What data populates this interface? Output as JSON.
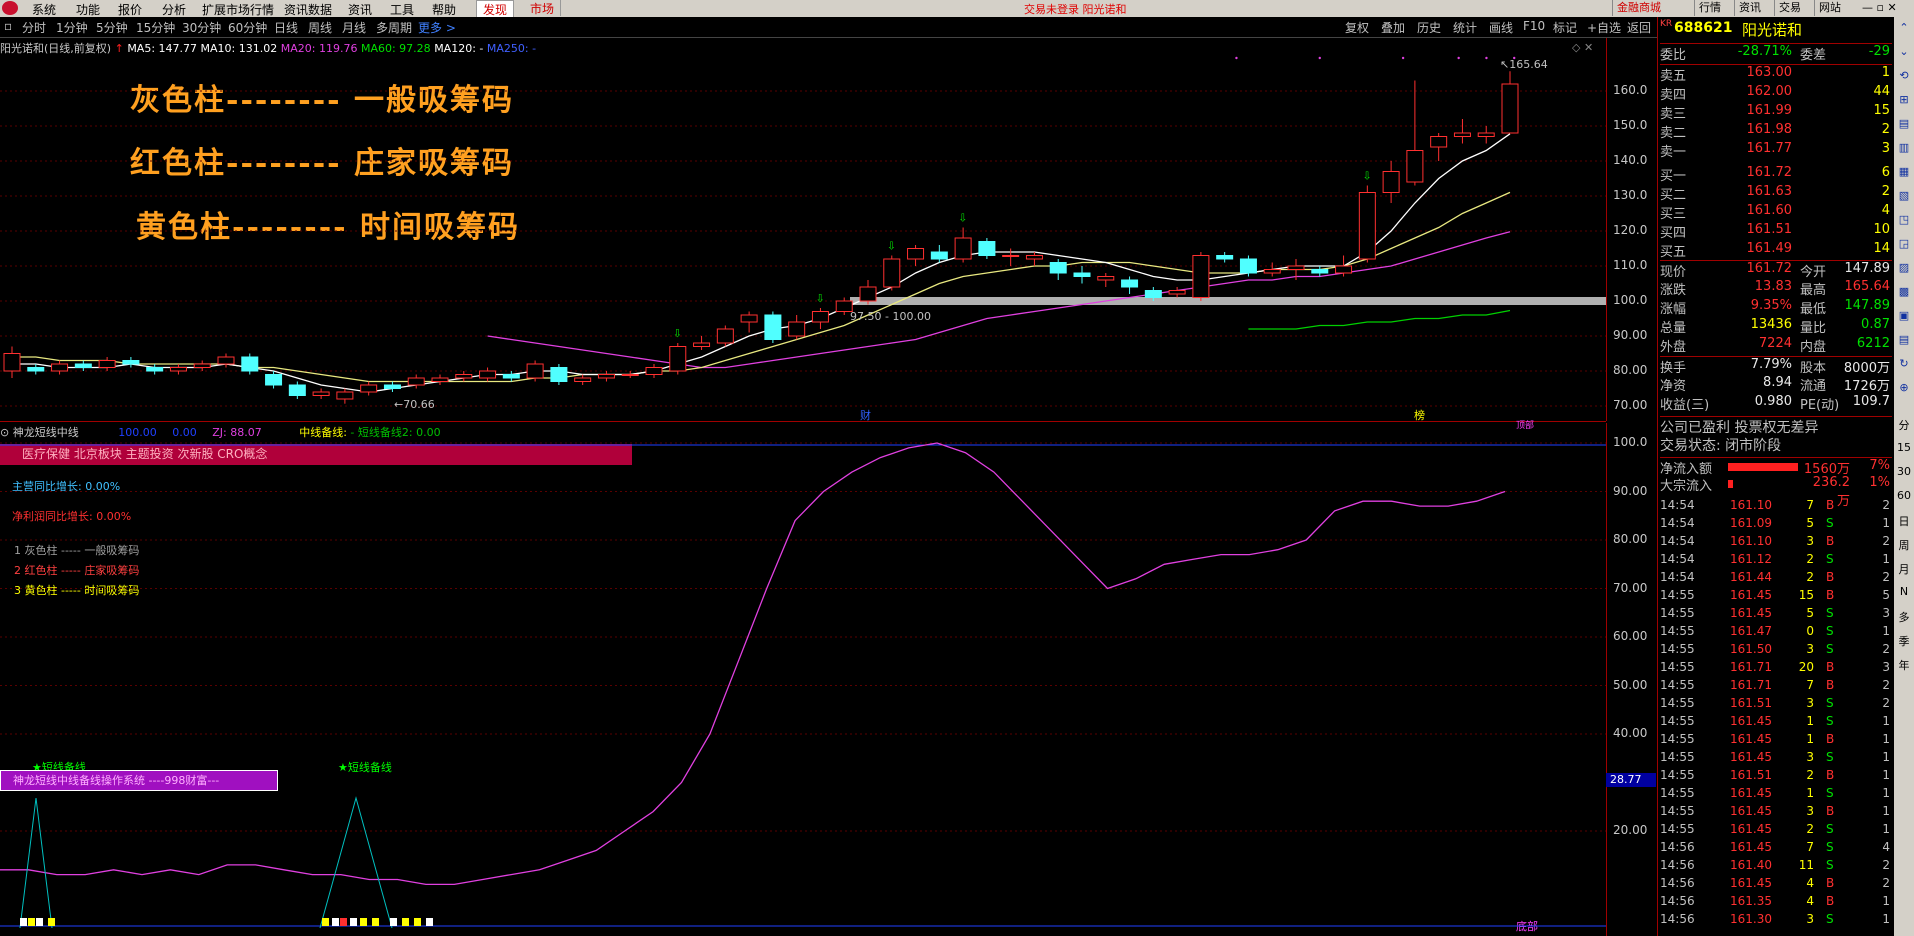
{
  "menu": {
    "items": [
      "系统",
      "功能",
      "报价",
      "分析",
      "扩展市场行情",
      "资讯数据",
      "资讯",
      "工具",
      "帮助"
    ],
    "tab_active": "发现",
    "tab_market": "市场",
    "status_text": "交易未登录  阳光诺和",
    "right_buttons": [
      "金融商城",
      "行情",
      "资讯",
      "交易",
      "网站"
    ]
  },
  "toolbar": {
    "periods": [
      "分时",
      "1分钟",
      "5分钟",
      "15分钟",
      "30分钟",
      "60分钟",
      "日线",
      "周线",
      "月线",
      "多周期"
    ],
    "more": "更多 >",
    "right": [
      "复权",
      "叠加",
      "历史",
      "统计",
      "画线",
      "F10",
      "标记",
      "+自选",
      "返回"
    ]
  },
  "main": {
    "title": "阳光诺和(日线,前复权)",
    "ma": [
      {
        "label": "MA5: 147.77",
        "color": "#ffffff"
      },
      {
        "label": "MA10: 131.02",
        "color": "#ffffff"
      },
      {
        "label": "MA20: 119.76",
        "color": "#e040e0"
      },
      {
        "label": "MA60: 97.28",
        "color": "#00e000"
      },
      {
        "label": "MA120: -",
        "color": "#ffffff"
      },
      {
        "label": "MA250: -",
        "color": "#4060ff"
      }
    ],
    "annotations": [
      "灰色柱--------    一般吸筹码",
      "红色柱--------    庄家吸筹码",
      "黄色柱--------    时间吸筹码"
    ],
    "high_label": "165.64",
    "low_label": "70.66",
    "range_label": "97.50 - 100.00",
    "marker_cai": "财",
    "marker_bang": "榜",
    "y_ticks": [
      "160.0",
      "150.0",
      "140.0",
      "130.0",
      "120.0",
      "110.0",
      "100.0",
      "90.00",
      "80.00",
      "70.00"
    ]
  },
  "sub": {
    "title": "神龙短线中线",
    "v1": "100.00",
    "v2": "0.00",
    "zj": "ZJ: 88.07",
    "line_label": "中线备线:",
    "line2": "- 短线备线2: 0.00",
    "concepts": "医疗保健 北京板块 主题投资 次新股 CRO概念",
    "growth1": "主营同比增长:  0.00%",
    "growth2": "净利润同比增长:  0.00%",
    "legend": [
      "1 灰色柱 ----- 一般吸筹码",
      "2 红色柱 -----  庄家吸筹码",
      "3 黄色柱 -----  时间吸筹码"
    ],
    "star_label": "★短线备线",
    "system_banner": "神龙短线中线备线操作系统 ----998财富---",
    "bottom_label": "底部",
    "top_label": "顶部",
    "cursor_value": "28.77",
    "y_ticks": [
      "100.0",
      "90.00",
      "80.00",
      "70.00",
      "60.00",
      "50.00",
      "40.00",
      "20.00"
    ],
    "line_values": [
      12,
      12,
      11,
      11,
      12,
      11,
      12,
      11,
      13,
      13,
      12,
      11,
      11,
      10,
      10,
      9,
      9,
      10,
      11,
      12,
      14,
      16,
      20,
      24,
      30,
      40,
      55,
      70,
      84,
      90,
      94,
      97,
      99,
      100,
      98,
      94,
      88,
      82,
      76,
      70,
      72,
      75,
      76,
      77,
      77,
      78,
      80,
      86,
      88,
      88,
      87,
      87,
      88,
      90
    ]
  },
  "panel": {
    "code": "688621",
    "name": "阳光诺和",
    "kr": "KR",
    "weibi": {
      "label": "委比",
      "value": "-28.71%",
      "label2": "委差",
      "value2": "-29"
    },
    "asks": [
      {
        "label": "卖五",
        "price": "163.00",
        "vol": "1"
      },
      {
        "label": "卖四",
        "price": "162.00",
        "vol": "44"
      },
      {
        "label": "卖三",
        "price": "161.99",
        "vol": "15"
      },
      {
        "label": "卖二",
        "price": "161.98",
        "vol": "2"
      },
      {
        "label": "卖一",
        "price": "161.77",
        "vol": "3"
      }
    ],
    "bids": [
      {
        "label": "买一",
        "price": "161.72",
        "vol": "6"
      },
      {
        "label": "买二",
        "price": "161.63",
        "vol": "2"
      },
      {
        "label": "买三",
        "price": "161.60",
        "vol": "4"
      },
      {
        "label": "买四",
        "price": "161.51",
        "vol": "10"
      },
      {
        "label": "买五",
        "price": "161.49",
        "vol": "14"
      }
    ],
    "quote": [
      {
        "l1": "现价",
        "v1": "161.72",
        "l2": "今开",
        "v2": "147.89"
      },
      {
        "l1": "涨跌",
        "v1": "13.83",
        "l2": "最高",
        "v2": "165.64"
      },
      {
        "l1": "涨幅",
        "v1": "9.35%",
        "l2": "最低",
        "v2": "147.89"
      },
      {
        "l1": "总量",
        "v1": "13436",
        "l2": "量比",
        "v2": "0.87"
      },
      {
        "l1": "外盘",
        "v1": "7224",
        "l2": "内盘",
        "v2": "6212"
      }
    ],
    "stats": [
      {
        "l1": "换手",
        "v1": "7.79%",
        "l2": "股本",
        "v2": "8000万"
      },
      {
        "l1": "净资",
        "v1": "8.94",
        "l2": "流通",
        "v2": "1726万"
      },
      {
        "l1": "收益(三)",
        "v1": "0.980",
        "l2": "PE(动)",
        "v2": "109.7"
      }
    ],
    "info1": "公司已盈利 投票权无差异",
    "info2": "交易状态: 闭市阶段",
    "flow": [
      {
        "label": "净流入额",
        "value": "1560万",
        "pct": "7%",
        "fill": 0.78
      },
      {
        "label": "大宗流入",
        "value": "236.2万",
        "pct": "1%",
        "fill": 0.06
      }
    ],
    "ticks": [
      [
        "14:54",
        "161.10",
        "7",
        "B",
        "2"
      ],
      [
        "14:54",
        "161.09",
        "5",
        "S",
        "1"
      ],
      [
        "14:54",
        "161.10",
        "3",
        "B",
        "2"
      ],
      [
        "14:54",
        "161.12",
        "2",
        "S",
        "1"
      ],
      [
        "14:54",
        "161.44",
        "2",
        "B",
        "2"
      ],
      [
        "14:55",
        "161.45",
        "15",
        "B",
        "5"
      ],
      [
        "14:55",
        "161.45",
        "5",
        "S",
        "3"
      ],
      [
        "14:55",
        "161.47",
        "0",
        "S",
        "1"
      ],
      [
        "14:55",
        "161.50",
        "3",
        "S",
        "2"
      ],
      [
        "14:55",
        "161.71",
        "20",
        "B",
        "3"
      ],
      [
        "14:55",
        "161.71",
        "7",
        "B",
        "2"
      ],
      [
        "14:55",
        "161.51",
        "3",
        "S",
        "2"
      ],
      [
        "14:55",
        "161.45",
        "1",
        "S",
        "1"
      ],
      [
        "14:55",
        "161.45",
        "1",
        "B",
        "1"
      ],
      [
        "14:55",
        "161.45",
        "3",
        "S",
        "1"
      ],
      [
        "14:55",
        "161.51",
        "2",
        "B",
        "1"
      ],
      [
        "14:55",
        "161.45",
        "1",
        "S",
        "1"
      ],
      [
        "14:55",
        "161.45",
        "3",
        "B",
        "1"
      ],
      [
        "14:55",
        "161.45",
        "2",
        "S",
        "1"
      ],
      [
        "14:56",
        "161.45",
        "7",
        "S",
        "4"
      ],
      [
        "14:56",
        "161.40",
        "11",
        "S",
        "2"
      ],
      [
        "14:56",
        "161.45",
        "4",
        "B",
        "2"
      ],
      [
        "14:56",
        "161.35",
        "4",
        "B",
        "1"
      ],
      [
        "14:56",
        "161.30",
        "3",
        "S",
        "1"
      ]
    ]
  },
  "sidebar": [
    "分",
    "15",
    "30",
    "60",
    "日",
    "周",
    "月",
    "N",
    "多",
    "季",
    "年"
  ],
  "chart_data": {
    "type": "candlestick",
    "title": "阳光诺和(日线,前复权)",
    "ylim": [
      68,
      168
    ],
    "candles": [
      {
        "o": 80,
        "c": 85,
        "h": 87,
        "l": 78
      },
      {
        "o": 81,
        "c": 80,
        "h": 82,
        "l": 79
      },
      {
        "o": 80,
        "c": 82,
        "h": 83,
        "l": 79
      },
      {
        "o": 82,
        "c": 81,
        "h": 83,
        "l": 80
      },
      {
        "o": 81,
        "c": 83,
        "h": 84,
        "l": 80
      },
      {
        "o": 83,
        "c": 82,
        "h": 84,
        "l": 81
      },
      {
        "o": 81,
        "c": 80,
        "h": 82,
        "l": 79
      },
      {
        "o": 80,
        "c": 81,
        "h": 82,
        "l": 79
      },
      {
        "o": 81,
        "c": 82,
        "h": 83,
        "l": 80
      },
      {
        "o": 82,
        "c": 84,
        "h": 85,
        "l": 81
      },
      {
        "o": 84,
        "c": 80,
        "h": 85,
        "l": 79
      },
      {
        "o": 79,
        "c": 76,
        "h": 80,
        "l": 75
      },
      {
        "o": 76,
        "c": 73,
        "h": 77,
        "l": 72
      },
      {
        "o": 73,
        "c": 74,
        "h": 75,
        "l": 72
      },
      {
        "o": 72,
        "c": 74,
        "h": 75,
        "l": 70.66
      },
      {
        "o": 74,
        "c": 76,
        "h": 77,
        "l": 73
      },
      {
        "o": 76,
        "c": 75,
        "h": 77,
        "l": 74
      },
      {
        "o": 76,
        "c": 78,
        "h": 79,
        "l": 75
      },
      {
        "o": 77,
        "c": 78,
        "h": 79,
        "l": 76
      },
      {
        "o": 78,
        "c": 79,
        "h": 80,
        "l": 77
      },
      {
        "o": 78,
        "c": 80,
        "h": 81,
        "l": 77
      },
      {
        "o": 79,
        "c": 78,
        "h": 80,
        "l": 77
      },
      {
        "o": 78,
        "c": 82,
        "h": 83,
        "l": 77
      },
      {
        "o": 81,
        "c": 77,
        "h": 82,
        "l": 76
      },
      {
        "o": 77,
        "c": 78,
        "h": 79,
        "l": 76
      },
      {
        "o": 78,
        "c": 79,
        "h": 80,
        "l": 77
      },
      {
        "o": 79,
        "c": 79,
        "h": 80,
        "l": 78
      },
      {
        "o": 79,
        "c": 81,
        "h": 82,
        "l": 78
      },
      {
        "o": 80,
        "c": 87,
        "h": 88,
        "l": 79
      },
      {
        "o": 87,
        "c": 88,
        "h": 90,
        "l": 86
      },
      {
        "o": 88,
        "c": 92,
        "h": 93,
        "l": 87
      },
      {
        "o": 94,
        "c": 96,
        "h": 97,
        "l": 91
      },
      {
        "o": 96,
        "c": 89,
        "h": 97,
        "l": 88
      },
      {
        "o": 90,
        "c": 94,
        "h": 96,
        "l": 89
      },
      {
        "o": 94,
        "c": 97,
        "h": 98,
        "l": 92
      },
      {
        "o": 97,
        "c": 100,
        "h": 101,
        "l": 96
      },
      {
        "o": 100,
        "c": 104,
        "h": 106,
        "l": 99
      },
      {
        "o": 104,
        "c": 112,
        "h": 113,
        "l": 103
      },
      {
        "o": 112,
        "c": 115,
        "h": 116,
        "l": 110
      },
      {
        "o": 114,
        "c": 112,
        "h": 116,
        "l": 111
      },
      {
        "o": 112,
        "c": 118,
        "h": 121,
        "l": 111
      },
      {
        "o": 117,
        "c": 113,
        "h": 118,
        "l": 112
      },
      {
        "o": 113,
        "c": 113,
        "h": 115,
        "l": 110
      },
      {
        "o": 112,
        "c": 113,
        "h": 114,
        "l": 110
      },
      {
        "o": 111,
        "c": 108,
        "h": 112,
        "l": 106
      },
      {
        "o": 108,
        "c": 107,
        "h": 110,
        "l": 105
      },
      {
        "o": 106,
        "c": 107,
        "h": 108,
        "l": 104
      },
      {
        "o": 106,
        "c": 104,
        "h": 107,
        "l": 102
      },
      {
        "o": 103,
        "c": 101,
        "h": 104,
        "l": 100
      },
      {
        "o": 102,
        "c": 103,
        "h": 104,
        "l": 101
      },
      {
        "o": 101,
        "c": 113,
        "h": 114,
        "l": 100
      },
      {
        "o": 113,
        "c": 112,
        "h": 114,
        "l": 111
      },
      {
        "o": 112,
        "c": 108,
        "h": 113,
        "l": 107
      },
      {
        "o": 108,
        "c": 109,
        "h": 111,
        "l": 107
      },
      {
        "o": 109,
        "c": 110,
        "h": 112,
        "l": 106
      },
      {
        "o": 109,
        "c": 108,
        "h": 110,
        "l": 107
      },
      {
        "o": 108,
        "c": 110,
        "h": 113,
        "l": 107
      },
      {
        "o": 112,
        "c": 131,
        "h": 133,
        "l": 111
      },
      {
        "o": 131,
        "c": 137,
        "h": 140,
        "l": 128
      },
      {
        "o": 134,
        "c": 143,
        "h": 163,
        "l": 133
      },
      {
        "o": 144,
        "c": 147,
        "h": 148,
        "l": 140
      },
      {
        "o": 147,
        "c": 148,
        "h": 152,
        "l": 145
      },
      {
        "o": 147,
        "c": 148,
        "h": 150,
        "l": 145
      },
      {
        "o": 148,
        "c": 162,
        "h": 165.64,
        "l": 147.89
      }
    ],
    "ma5": [
      82,
      82,
      81,
      81,
      81,
      82,
      81,
      81,
      81,
      82,
      81,
      80,
      78,
      76,
      75,
      74,
      75,
      76,
      77,
      78,
      79,
      79,
      80,
      80,
      79,
      79,
      79,
      80,
      82,
      84,
      87,
      90,
      92,
      93,
      95,
      98,
      101,
      104,
      108,
      111,
      113,
      114,
      114,
      114,
      113,
      112,
      111,
      109,
      107,
      106,
      106,
      107,
      108,
      109,
      110,
      110,
      110,
      114,
      120,
      128,
      135,
      140,
      143,
      147.77
    ],
    "ma10": [
      84,
      84,
      83,
      83,
      83,
      82,
      82,
      82,
      82,
      82,
      81,
      81,
      80,
      79,
      78,
      77,
      77,
      77,
      77,
      77,
      77,
      77,
      78,
      78,
      79,
      79,
      79,
      80,
      80,
      81,
      83,
      85,
      87,
      89,
      91,
      93,
      96,
      99,
      102,
      105,
      107,
      108,
      109,
      110,
      110,
      111,
      111,
      111,
      110,
      109,
      108,
      108,
      108,
      109,
      109,
      109,
      110,
      112,
      115,
      118,
      121,
      125,
      128,
      131.02
    ],
    "ma20": [
      null,
      null,
      null,
      null,
      null,
      null,
      null,
      null,
      null,
      null,
      null,
      null,
      null,
      null,
      null,
      null,
      null,
      null,
      null,
      null,
      90,
      89,
      88,
      87,
      86,
      85,
      84,
      83,
      82,
      81,
      81,
      82,
      83,
      84,
      85,
      86,
      87,
      88,
      89,
      91,
      93,
      95,
      96,
      97,
      98,
      99,
      100,
      101,
      102,
      103,
      104,
      105,
      106,
      106,
      107,
      107,
      108,
      109,
      110,
      112,
      114,
      116,
      118,
      119.76
    ],
    "ma60": [
      null,
      null,
      null,
      null,
      null,
      null,
      null,
      null,
      null,
      null,
      null,
      null,
      null,
      null,
      null,
      null,
      null,
      null,
      null,
      null,
      null,
      null,
      null,
      null,
      null,
      null,
      null,
      null,
      null,
      null,
      null,
      null,
      null,
      null,
      null,
      null,
      null,
      null,
      null,
      null,
      null,
      null,
      null,
      null,
      null,
      null,
      null,
      null,
      null,
      null,
      null,
      null,
      92,
      92,
      92,
      93,
      93,
      94,
      94,
      95,
      95,
      96,
      96,
      97.28
    ],
    "ma5_label": "MA5",
    "ma10_label": "MA10",
    "ma20_label": "MA20",
    "ma60_label": "MA60"
  },
  "colors": {
    "up": "#ff3030",
    "down": "#50ffff",
    "bg": "#000000",
    "grid": "#5a0000",
    "ma20": "#e040e0",
    "ma60": "#00d000",
    "ma10": "#e8e880",
    "ma5": "#ffffff"
  }
}
